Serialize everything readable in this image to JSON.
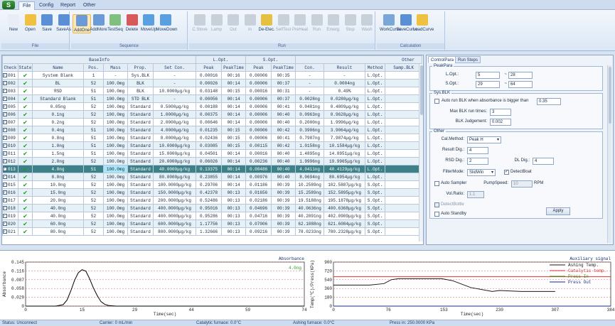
{
  "app": {
    "logo": "S"
  },
  "tabs": [
    {
      "label": "File",
      "active": true
    },
    {
      "label": "Config",
      "active": false
    },
    {
      "label": "Report",
      "active": false
    },
    {
      "label": "Other",
      "active": false
    }
  ],
  "ribbon": {
    "file_group": {
      "label": "File",
      "buttons": [
        {
          "label": "New",
          "icon": "new-file-icon",
          "color": "#e8eef7"
        },
        {
          "label": "Open",
          "icon": "open-folder-icon",
          "color": "#f0c040"
        },
        {
          "label": "Save",
          "icon": "save-icon",
          "color": "#5a8fd6"
        },
        {
          "label": "SaveAs",
          "icon": "save-as-icon",
          "color": "#5a8fd6"
        }
      ]
    },
    "sequence_group": {
      "label": "Sequence",
      "buttons": [
        {
          "label": "AddOne",
          "icon": "add-one-icon",
          "color": "#6b9ad8",
          "selected": true
        },
        {
          "label": "AddMore",
          "icon": "add-more-icon",
          "color": "#6b9ad8"
        },
        {
          "label": "TestSeq",
          "icon": "test-seq-icon",
          "color": "#7fbf7f"
        },
        {
          "label": "Delete",
          "icon": "delete-icon",
          "color": "#d65a5a"
        },
        {
          "label": "MoveUp",
          "icon": "move-up-icon",
          "color": "#5aa0e0"
        },
        {
          "label": "MoveDown",
          "icon": "move-down-icon",
          "color": "#5aa0e0"
        }
      ]
    },
    "run_group": {
      "label": "Run",
      "buttons": [
        {
          "label": "C.Stove",
          "icon": "stove-icon",
          "disabled": true
        },
        {
          "label": "Lamp",
          "icon": "lamp-icon",
          "disabled": true
        },
        {
          "label": "Out",
          "icon": "out-icon",
          "disabled": true
        },
        {
          "label": "In",
          "icon": "in-icon",
          "disabled": true
        },
        {
          "label": "De-Elec.",
          "icon": "de-elec-icon",
          "color": "#e6c040"
        },
        {
          "label": "SelfTest",
          "icon": "self-test-icon",
          "disabled": true
        },
        {
          "label": "PreHeat",
          "icon": "preheat-icon",
          "disabled": true
        },
        {
          "label": "Run",
          "icon": "run-icon",
          "disabled": true
        },
        {
          "label": "Emerg.",
          "icon": "emergency-icon",
          "disabled": true
        },
        {
          "label": "Stop",
          "icon": "stop-icon",
          "disabled": true
        },
        {
          "label": "Wash",
          "icon": "wash-icon",
          "disabled": true
        }
      ]
    },
    "calc_group": {
      "label": "Calculation",
      "buttons": [
        {
          "label": "WorkCurve",
          "icon": "work-curve-icon",
          "color": "#7aa7d8"
        },
        {
          "label": "SaveCurve",
          "icon": "save-curve-icon",
          "color": "#5a8fd6"
        },
        {
          "label": "LoadCurve",
          "icon": "load-curve-icon",
          "color": "#f0c040"
        }
      ]
    }
  },
  "table": {
    "group_headers": {
      "baseinfo": "BaseInfo",
      "lopt": "L.Opt.",
      "sopt": "S.Opt.",
      "other": "Other"
    },
    "columns": [
      "Check",
      "State",
      "Name",
      "Pos.",
      "Mass",
      "Prop.",
      "Set Con.",
      "Peak",
      "PeakTime",
      "Peak",
      "PeakTime",
      "Con.",
      "Result",
      "Method",
      "Samp.BLK"
    ],
    "rows": [
      [
        "001",
        "System Blank",
        "1",
        "-",
        "Sys.BLK",
        "-",
        "0.00016",
        "00:16",
        "0.00006",
        "00:35",
        "-",
        "-",
        "L.Opt.",
        ""
      ],
      [
        "002",
        "BL",
        "52",
        "100.0mg",
        "BLK",
        "-",
        "0.00026",
        "00:14",
        "0.00006",
        "00:37",
        "-",
        "0.0004ng",
        "L.Opt.",
        ""
      ],
      [
        "003",
        "RSD",
        "51",
        "100.0mg",
        "BLK",
        "10.0000μg/kg",
        "0.03148",
        "00:15",
        "0.00016",
        "00:31",
        "-",
        "0.49%",
        "L.Opt.",
        ""
      ],
      [
        "004",
        "Standard Blank",
        "51",
        "100.0mg",
        "STD BLK",
        "-",
        "0.00056",
        "00:14",
        "0.00006",
        "00:37",
        "0.0028ng",
        "0.0280μg/kg",
        "L.Opt.",
        ""
      ],
      [
        "005",
        "0.05ng",
        "52",
        "100.0mg",
        "Standard",
        "0.5000μg/kg",
        "0.00188",
        "00:14",
        "0.00006",
        "00:41",
        "0.0481ng",
        "0.4809μg/kg",
        "L.Opt.",
        ""
      ],
      [
        "006",
        "0.1ng",
        "52",
        "100.0mg",
        "Standard",
        "1.0000μg/kg",
        "0.00375",
        "00:14",
        "0.00006",
        "00:40",
        "0.0963ng",
        "0.9628μg/kg",
        "L.Opt.",
        ""
      ],
      [
        "007",
        "0.2ng",
        "52",
        "100.0mg",
        "Standard",
        "2.0000μg/kg",
        "0.00646",
        "00:14",
        "0.00006",
        "00:40",
        "0.2000ng",
        "1.9996μg/kg",
        "L.Opt.",
        ""
      ],
      [
        "008",
        "0.4ng",
        "51",
        "100.0mg",
        "Standard",
        "4.0000μg/kg",
        "0.01235",
        "00:15",
        "0.00006",
        "00:42",
        "0.3906ng",
        "3.9064μg/kg",
        "L.Opt.",
        ""
      ],
      [
        "009",
        "0.8ng",
        "51",
        "100.0mg",
        "Standard",
        "8.0000μg/kg",
        "0.02436",
        "00:15",
        "0.00006",
        "00:41",
        "0.7987ng",
        "7.9874μg/kg",
        "L.Opt.",
        ""
      ],
      [
        "010",
        "1.0ng",
        "51",
        "100.0mg",
        "Standard",
        "10.0000μg/kg",
        "0.03085",
        "00:15",
        "0.00115",
        "00:42",
        "1.0158ng",
        "10.1584μg/kg",
        "L.Opt.",
        ""
      ],
      [
        "011",
        "1.5ng",
        "51",
        "100.0mg",
        "Standard",
        "15.0000μg/kg",
        "0.04501",
        "00:14",
        "0.00016",
        "00:40",
        "1.4895ng",
        "14.8951μg/kg",
        "L.Opt.",
        ""
      ],
      [
        "012",
        "2.0ng",
        "52",
        "100.0mg",
        "Standard",
        "20.0000μg/kg",
        "0.06026",
        "00:14",
        "0.00236",
        "00:40",
        "1.9996ng",
        "19.9965μg/kg",
        "L.Opt.",
        ""
      ],
      [
        "013",
        "4.0ng",
        "51",
        "100.0mg",
        "Standard",
        "40.0000μg/kg",
        "0.13375",
        "00:14",
        "0.00486",
        "00:40",
        "4.0411ng",
        "40.4129μg/kg",
        "L.Opt.",
        ""
      ],
      [
        "014",
        "8.0ng",
        "52",
        "100.0mg",
        "Standard",
        "80.0000μg/kg",
        "0.23855",
        "00:14",
        "0.00976",
        "00:40",
        "8.0694ng",
        "80.6954μg/kg",
        "L.Opt.",
        ""
      ],
      [
        "015",
        "10.0ng",
        "52",
        "100.0mg",
        "Standard",
        "100.0000μg/kg",
        "0.29706",
        "00:14",
        "0.01186",
        "00:39",
        "10.2589ng",
        "102.5887μg/kg",
        "S.Opt.",
        ""
      ],
      [
        "016",
        "15.0ng",
        "52",
        "100.0mg",
        "Standard",
        "150.0000μg/kg",
        "0.42378",
        "00:13",
        "0.01656",
        "00:39",
        "15.2589ng",
        "152.5895μg/kg",
        "S.Opt.",
        ""
      ],
      [
        "017",
        "20.0ng",
        "52",
        "100.0mg",
        "Standard",
        "200.0000μg/kg",
        "0.52486",
        "00:13",
        "0.02186",
        "00:39",
        "19.5188ng",
        "195.1878μg/kg",
        "S.Opt.",
        ""
      ],
      [
        "018",
        "40.0ng",
        "52",
        "100.0mg",
        "Standard",
        "400.0000μg/kg",
        "0.95016",
        "00:13",
        "0.04696",
        "00:39",
        "40.0636ng",
        "400.6368μg/kg",
        "S.Opt.",
        ""
      ],
      [
        "019",
        "40.0ng",
        "52",
        "100.0mg",
        "Standard",
        "400.0000μg/kg",
        "0.95286",
        "00:13",
        "0.04716",
        "00:39",
        "40.2091ng",
        "402.0909μg/kg",
        "S.Opt.",
        ""
      ],
      [
        "020",
        "60.0ng",
        "52",
        "100.0mg",
        "Standard",
        "600.0000μg/kg",
        "1.17756",
        "00:13",
        "0.07006",
        "00:39",
        "62.1088ng",
        "621.6084μg/kg",
        "S.Opt.",
        ""
      ],
      [
        "021",
        "80.0ng",
        "52",
        "100.0mg",
        "Standard",
        "800.0000μg/kg",
        "1.32666",
        "00:13",
        "0.09216",
        "00:39",
        "78.0233ng",
        "780.2328μg/kg",
        "S.Opt.",
        ""
      ]
    ],
    "selected_index": 12
  },
  "right_panel": {
    "tabs": [
      "ControlPara",
      "Run Steps"
    ],
    "peakpara": {
      "legend": "PeakPara",
      "lopt_label": "L.Opt.:",
      "lopt_from": "5",
      "lopt_to": "28",
      "sopt_label": "S.Opt.:",
      "sopt_from": "29",
      "sopt_to": "64",
      "range_sep": "~"
    },
    "sysblk": {
      "legend": "Sys.BLK",
      "auto_label": "Auto run BLK when absorbance is bigger than",
      "auto_value": "0.35",
      "max_label": "Max BLK run times:",
      "max_value": "3",
      "judge_label": "BLK Judgement:",
      "judge_value": "0.002"
    },
    "other": {
      "legend": "Other",
      "cal_label": "Cal.Method:",
      "cal_value": "Peak H",
      "result_label": "Result Dig.:",
      "result_value": "4",
      "rsd_label": "RSD Dig.:",
      "rsd_value": "2",
      "dl_label": "DL Dig.:",
      "dl_value": "4",
      "filter_label": "FilterMode:",
      "filter_value": "SlidWin",
      "detect_boat": "DetectBoat",
      "auto_sampler": "Auto Sampler",
      "pump_label": "PumpSpeed:",
      "pump_value": "10",
      "pump_unit": "RPM",
      "vol_label": "Vol.Ratio:",
      "vol_value": "1.1",
      "detect_bottle": "DetectBottle",
      "auto_standby": "Auto Standby",
      "apply": "Apply"
    }
  },
  "chart_data": [
    {
      "type": "line",
      "title": "Absorbance",
      "ylabel": "Absorbance",
      "xlabel": "Time(sec)",
      "annotation": "4.0ng",
      "xlim": [
        0,
        74
      ],
      "ylim": [
        0,
        0.145
      ],
      "x_ticks": [
        0,
        15,
        29,
        44,
        59,
        74
      ],
      "y_ticks": [
        0,
        0.029,
        0.058,
        0.087,
        0.116,
        0.145
      ],
      "x_tick_labels": [
        "0",
        "15",
        "29",
        "44",
        "59",
        "74"
      ],
      "y_tick_labels": [
        "0",
        "0.029",
        "0.058",
        "0.087",
        "0.116",
        "0.145"
      ],
      "series": [
        {
          "color": "#000000",
          "x": [
            0,
            8,
            10,
            11,
            12,
            13,
            14,
            15,
            16,
            17,
            18,
            19,
            20,
            21,
            22,
            24,
            26,
            30,
            74
          ],
          "y": [
            0,
            0,
            0.005,
            0.02,
            0.05,
            0.085,
            0.11,
            0.12,
            0.115,
            0.09,
            0.06,
            0.035,
            0.015,
            0.006,
            0.002,
            0,
            0,
            0,
            0
          ]
        }
      ]
    },
    {
      "type": "line",
      "title": "Auxiliary signal",
      "ylabel": "Temp(℃)/Press(KPa)",
      "xlabel": "Time(sec)",
      "xlim": [
        0,
        384
      ],
      "ylim": [
        0,
        900
      ],
      "x_ticks": [
        0,
        76,
        153,
        230,
        307,
        384
      ],
      "y_ticks": [
        0,
        180,
        360,
        540,
        720,
        900
      ],
      "x_tick_labels": [
        "0",
        "76",
        "153",
        "230",
        "307",
        "384"
      ],
      "y_tick_labels": [
        "0",
        "180",
        "360",
        "540",
        "720",
        "900"
      ],
      "series": [
        {
          "name": "Ashing Temp.",
          "color": "#1a1a1a",
          "x": [
            0,
            50,
            70,
            80,
            90,
            150,
            165,
            190,
            220,
            230,
            260,
            307
          ],
          "y": [
            430,
            430,
            460,
            540,
            560,
            560,
            520,
            380,
            300,
            320,
            300,
            300
          ]
        },
        {
          "name": "Catalytic temp.",
          "color": "#e03030",
          "x": [
            0,
            384
          ],
          "y": [
            600,
            600
          ]
        },
        {
          "name": "Press In",
          "color": "#2a9a2a",
          "x": [
            0,
            384
          ],
          "y": [
            0,
            0
          ]
        },
        {
          "name": "Press Out",
          "color": "#1a2a8a",
          "x": [
            0,
            384
          ],
          "y": [
            0,
            0
          ]
        }
      ]
    }
  ],
  "status": {
    "status": "Status:  Unconnect",
    "carrier": "Carrier:  0 mL/min",
    "catalytic": "Catalytic furnace:  0.0°C",
    "ashing": "Ashing furnace:  0.0°C",
    "press": "Press in:  250.0000 KPa"
  }
}
